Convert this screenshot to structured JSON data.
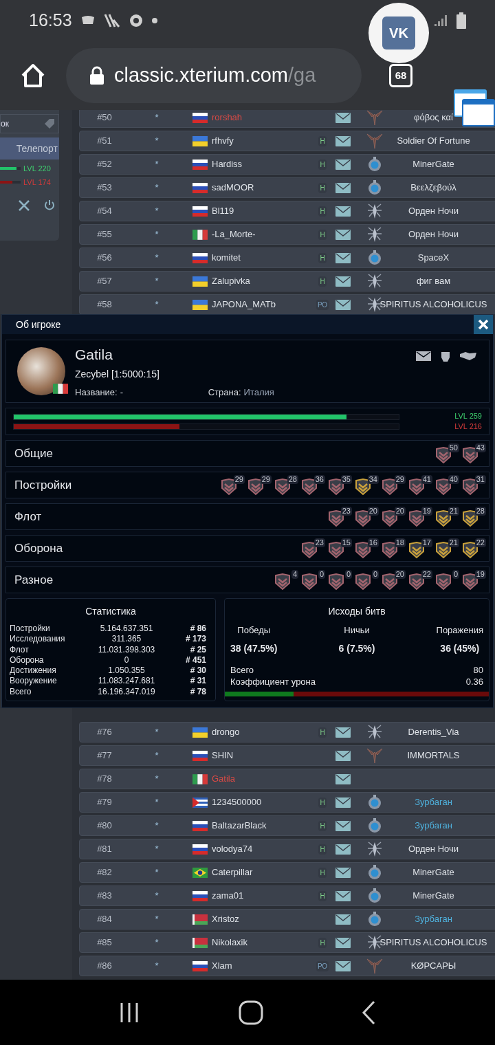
{
  "status_bar": {
    "time": "16:53"
  },
  "browser": {
    "url_host": "classic.xterium.com",
    "url_path": "/ga",
    "tab_count": "68",
    "bubble_label": "VK"
  },
  "sidebar": {
    "field_text": "ок",
    "teleport": "Телепорт",
    "levels": [
      {
        "label": "LVL 220",
        "kind": "green",
        "level": 0.8
      },
      {
        "label": "LVL 174",
        "kind": "red",
        "level": 0.6
      }
    ]
  },
  "rows_top": [
    {
      "rank": "#50",
      "star": "*",
      "flag": {
        "kind": "ru"
      },
      "name": "rorshah",
      "highlighted": true,
      "emblem": {
        "kind": "demon"
      },
      "alliance": "φόβος καί",
      "alliance_link": false
    },
    {
      "rank": "#51",
      "star": "*",
      "flag": {
        "kind": "ua"
      },
      "name": "rfhvfy",
      "highlighted": false,
      "badge": "Н",
      "emblem": {
        "kind": "demon"
      },
      "alliance": "Soldier Of Fortune",
      "alliance_link": false
    },
    {
      "rank": "#52",
      "star": "*",
      "flag": {
        "kind": "ru"
      },
      "name": "Hardiss",
      "highlighted": false,
      "badge": "Н",
      "emblem": {
        "kind": "orb"
      },
      "alliance": "MinerGate",
      "alliance_link": false
    },
    {
      "rank": "#53",
      "star": "*",
      "flag": {
        "kind": "ru"
      },
      "name": "sadMOOR",
      "highlighted": false,
      "badge": "Н",
      "emblem": {
        "kind": "orb"
      },
      "alliance": "Βεελζεβούλ",
      "alliance_link": false
    },
    {
      "rank": "#54",
      "star": "*",
      "flag": {
        "kind": "ru"
      },
      "name": "Bl119",
      "highlighted": false,
      "badge": "Н",
      "emblem": {
        "kind": "spider"
      },
      "alliance": "Орден Ночи",
      "alliance_link": false
    },
    {
      "rank": "#55",
      "star": "*",
      "flag": {
        "kind": "it"
      },
      "name": "-La_Morte-",
      "highlighted": false,
      "badge": "Н",
      "emblem": {
        "kind": "spider"
      },
      "alliance": "Орден Ночи",
      "alliance_link": false
    },
    {
      "rank": "#56",
      "star": "*",
      "flag": {
        "kind": "ru"
      },
      "name": "komitet",
      "highlighted": false,
      "badge": "Н",
      "emblem": {
        "kind": "orb"
      },
      "alliance": "SpaceX",
      "alliance_link": false
    },
    {
      "rank": "#57",
      "star": "*",
      "flag": {
        "kind": "ua"
      },
      "name": "Zalupivka",
      "highlighted": false,
      "badge": "Н",
      "emblem": {
        "kind": "spider"
      },
      "alliance": "фиг вам",
      "alliance_link": false
    },
    {
      "rank": "#58",
      "star": "*",
      "flag": {
        "kind": "ua"
      },
      "name": "JAPONA_MATb",
      "highlighted": false,
      "badge": "РО",
      "emblem": {
        "kind": "spider"
      },
      "alliance": "SPIRITUS ALCOHOLICUS",
      "alliance_link": false
    }
  ],
  "modal": {
    "title": "Об игроке",
    "player": {
      "name": "Gatila",
      "planet": "Zecybel [1:5000:15]",
      "flag": {
        "kind": "it"
      },
      "title_label": "Название:",
      "title_value": "-",
      "country_label": "Страна:",
      "country_value": "Италия"
    },
    "bars": [
      {
        "label": "LVL 259",
        "kind": "green",
        "level": 0.865
      },
      {
        "label": "LVL 216",
        "kind": "red",
        "level": 0.43
      }
    ],
    "achievements": [
      {
        "label": "Общие",
        "medals": [
          {
            "value": "50",
            "gold": false
          },
          {
            "value": "43",
            "gold": false
          }
        ]
      },
      {
        "label": "Постройки",
        "medals": [
          {
            "value": "29",
            "gold": false
          },
          {
            "value": "29",
            "gold": false
          },
          {
            "value": "28",
            "gold": false
          },
          {
            "value": "36",
            "gold": false
          },
          {
            "value": "35",
            "gold": false
          },
          {
            "value": "34",
            "gold": true
          },
          {
            "value": "29",
            "gold": false
          },
          {
            "value": "41",
            "gold": false
          },
          {
            "value": "40",
            "gold": false
          },
          {
            "value": "31",
            "gold": false
          }
        ]
      },
      {
        "label": "Флот",
        "medals": [
          {
            "value": "23",
            "gold": false
          },
          {
            "value": "20",
            "gold": false
          },
          {
            "value": "20",
            "gold": false
          },
          {
            "value": "19",
            "gold": false
          },
          {
            "value": "21",
            "gold": true
          },
          {
            "value": "28",
            "gold": true
          }
        ]
      },
      {
        "label": "Оборона",
        "medals": [
          {
            "value": "23",
            "gold": false
          },
          {
            "value": "15",
            "gold": false
          },
          {
            "value": "16",
            "gold": false
          },
          {
            "value": "18",
            "gold": false
          },
          {
            "value": "17",
            "gold": true
          },
          {
            "value": "21",
            "gold": true
          },
          {
            "value": "22",
            "gold": true
          }
        ]
      },
      {
        "label": "Разное",
        "medals": [
          {
            "value": "4",
            "gold": false
          },
          {
            "value": "0",
            "gold": false
          },
          {
            "value": "0",
            "gold": false
          },
          {
            "value": "0",
            "gold": false
          },
          {
            "value": "20",
            "gold": false
          },
          {
            "value": "22",
            "gold": false
          },
          {
            "value": "0",
            "gold": false
          },
          {
            "value": "19",
            "gold": false
          }
        ]
      }
    ],
    "statistics": {
      "title": "Статистика",
      "rows": [
        {
          "label": "Постройки",
          "value": "5.164.637.351",
          "rank": "# 86"
        },
        {
          "label": "Исследования",
          "value": "311.365",
          "rank": "# 173"
        },
        {
          "label": "Флот",
          "value": "11.031.398.303",
          "rank": "# 25"
        },
        {
          "label": "Оборона",
          "value": "0",
          "rank": "# 451"
        },
        {
          "label": "Достижения",
          "value": "1.050.355",
          "rank": "# 30"
        },
        {
          "label": "Вооружение",
          "value": "11.083.247.681",
          "rank": "# 31"
        },
        {
          "label": "Всего",
          "value": "16.196.347.019",
          "rank": "# 78"
        }
      ]
    },
    "battles": {
      "title": "Исходы битв",
      "outcomes": [
        {
          "label": "Победы",
          "value": "38 (47.5%)"
        },
        {
          "label": "Ничьи",
          "value": "6 (7.5%)"
        },
        {
          "label": "Поражения",
          "value": "36 (45%)"
        }
      ],
      "totals": [
        {
          "label": "Всего",
          "value": "80"
        },
        {
          "label": "Коэффициент урона",
          "value": "0.36"
        }
      ],
      "level": 0.26
    }
  },
  "rows_bottom": [
    {
      "rank": "#76",
      "star": "*",
      "flag": {
        "kind": "ua"
      },
      "name": "drongo",
      "highlighted": false,
      "badge": "Н",
      "emblem": {
        "kind": "spider"
      },
      "alliance": "Derentis_Via",
      "alliance_link": false
    },
    {
      "rank": "#77",
      "star": "*",
      "flag": {
        "kind": "ru"
      },
      "name": "SHIN",
      "highlighted": false,
      "emblem": {
        "kind": "demon"
      },
      "alliance": "IMMORTALS",
      "alliance_link": false
    },
    {
      "rank": "#78",
      "star": "*",
      "flag": {
        "kind": "it"
      },
      "name": "Gatila",
      "highlighted": true
    },
    {
      "rank": "#79",
      "star": "*",
      "flag": {
        "kind": "cu"
      },
      "name": "1234500000",
      "highlighted": false,
      "badge": "Н",
      "emblem": {
        "kind": "orb"
      },
      "alliance": "Зурбаган",
      "alliance_link": true
    },
    {
      "rank": "#80",
      "star": "*",
      "flag": {
        "kind": "ru"
      },
      "name": "BaltazarBlack",
      "highlighted": false,
      "badge": "Н",
      "emblem": {
        "kind": "orb"
      },
      "alliance": "Зурбаган",
      "alliance_link": true
    },
    {
      "rank": "#81",
      "star": "*",
      "flag": {
        "kind": "ru"
      },
      "name": "volodya74",
      "highlighted": false,
      "badge": "Н",
      "emblem": {
        "kind": "spider"
      },
      "alliance": "Орден Ночи",
      "alliance_link": false
    },
    {
      "rank": "#82",
      "star": "*",
      "flag": {
        "kind": "br"
      },
      "name": "Caterpillar",
      "highlighted": false,
      "badge": "Н",
      "emblem": {
        "kind": "orb"
      },
      "alliance": "MinerGate",
      "alliance_link": false
    },
    {
      "rank": "#83",
      "star": "*",
      "flag": {
        "kind": "ru"
      },
      "name": "zama01",
      "highlighted": false,
      "badge": "Н",
      "emblem": {
        "kind": "orb"
      },
      "alliance": "MinerGate",
      "alliance_link": false
    },
    {
      "rank": "#84",
      "star": "*",
      "flag": {
        "kind": "by"
      },
      "name": "Xristoz",
      "highlighted": false,
      "emblem": {
        "kind": "orb"
      },
      "alliance": "Зурбаган",
      "alliance_link": true
    },
    {
      "rank": "#85",
      "star": "*",
      "flag": {
        "kind": "by"
      },
      "name": "Nikolaxik",
      "highlighted": false,
      "badge": "Н",
      "emblem": {
        "kind": "spider"
      },
      "alliance": "SPIRITUS ALCOHOLICUS",
      "alliance_link": false
    },
    {
      "rank": "#86",
      "star": "*",
      "flag": {
        "kind": "ru"
      },
      "name": "Xlam",
      "highlighted": false,
      "badge": "РО",
      "emblem": {
        "kind": "demon"
      },
      "alliance": "KØPCAPЫ",
      "alliance_link": false
    }
  ]
}
